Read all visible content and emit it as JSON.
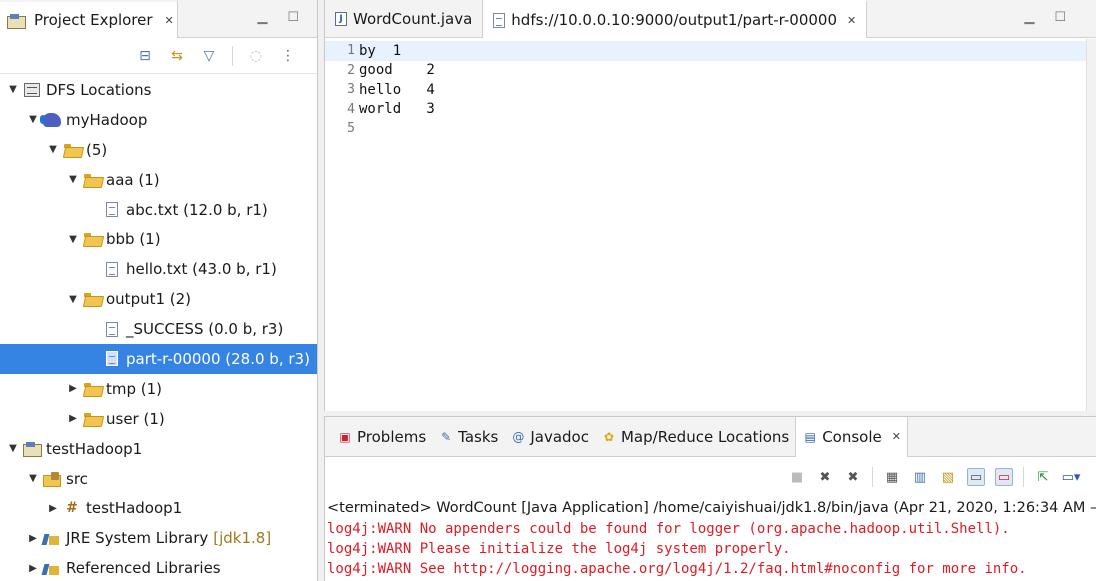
{
  "explorer": {
    "tab_title": "Project Explorer",
    "tree": [
      {
        "label": "DFS Locations",
        "level": 0,
        "expanded": true,
        "icon": "dfs-icon"
      },
      {
        "label": "myHadoop",
        "level": 1,
        "expanded": true,
        "icon": "elephant-icon"
      },
      {
        "label": "(5)",
        "level": 2,
        "expanded": true,
        "icon": "folder-open-icon"
      },
      {
        "label": "aaa (1)",
        "level": 3,
        "expanded": true,
        "icon": "folder-open-icon"
      },
      {
        "label": "abc.txt (12.0 b, r1)",
        "level": 4,
        "icon": "file-icon"
      },
      {
        "label": "bbb (1)",
        "level": 3,
        "expanded": true,
        "icon": "folder-open-icon"
      },
      {
        "label": "hello.txt (43.0 b, r1)",
        "level": 4,
        "icon": "file-icon"
      },
      {
        "label": "output1 (2)",
        "level": 3,
        "expanded": true,
        "icon": "folder-open-icon"
      },
      {
        "label": "_SUCCESS (0.0 b, r3)",
        "level": 4,
        "icon": "file-icon"
      },
      {
        "label": "part-r-00000 (28.0 b, r3)",
        "level": 4,
        "icon": "file-icon",
        "selected": true
      },
      {
        "label": "tmp (1)",
        "level": 3,
        "expanded": false,
        "icon": "folder-icon"
      },
      {
        "label": "user (1)",
        "level": 3,
        "expanded": false,
        "icon": "folder-icon"
      },
      {
        "label": "testHadoop1",
        "level": 0,
        "expanded": true,
        "icon": "project-icon"
      },
      {
        "label": "src",
        "level": 1,
        "expanded": true,
        "icon": "source-folder-icon"
      },
      {
        "label": "testHadoop1",
        "level": 2,
        "expanded": false,
        "icon": "package-icon"
      },
      {
        "label": "JRE System Library",
        "decoration": "[jdk1.8]",
        "level": 1,
        "expanded": false,
        "icon": "library-icon"
      },
      {
        "label": "Referenced Libraries",
        "level": 1,
        "expanded": false,
        "icon": "library-icon"
      }
    ]
  },
  "editor": {
    "tabs": [
      {
        "label": "WordCount.java",
        "icon": "java-file-icon",
        "active": false
      },
      {
        "label": "hdfs://10.0.0.10:9000/output1/part-r-00000",
        "icon": "text-file-icon",
        "active": true
      }
    ],
    "lines": [
      {
        "n": "1",
        "text": "by  1"
      },
      {
        "n": "2",
        "text": "good    2"
      },
      {
        "n": "3",
        "text": "hello   4"
      },
      {
        "n": "4",
        "text": "world   3"
      },
      {
        "n": "5",
        "text": ""
      }
    ]
  },
  "console": {
    "tabs": [
      {
        "label": "Problems",
        "icon": "problems-icon",
        "active": false
      },
      {
        "label": "Tasks",
        "icon": "tasks-icon",
        "active": false
      },
      {
        "label": "Javadoc",
        "icon": "javadoc-icon",
        "active": false
      },
      {
        "label": "Map/Reduce Locations",
        "icon": "mapreduce-icon",
        "active": false
      },
      {
        "label": "Console",
        "icon": "console-icon",
        "active": true
      }
    ],
    "terminated": "<terminated> WordCount [Java Application] /home/caiyishuai/jdk1.8/bin/java  (Apr 21, 2020, 1:26:34 AM –",
    "log": [
      "log4j:WARN No appenders could be found for logger (org.apache.hadoop.util.Shell).",
      "log4j:WARN Please initialize the log4j system properly.",
      "log4j:WARN See http://logging.apache.org/log4j/1.2/faq.html#noconfig for more info."
    ]
  },
  "colors": {
    "selection": "#3584e4",
    "log_red": "#e01b24",
    "current_line": "#e8f2fe"
  }
}
